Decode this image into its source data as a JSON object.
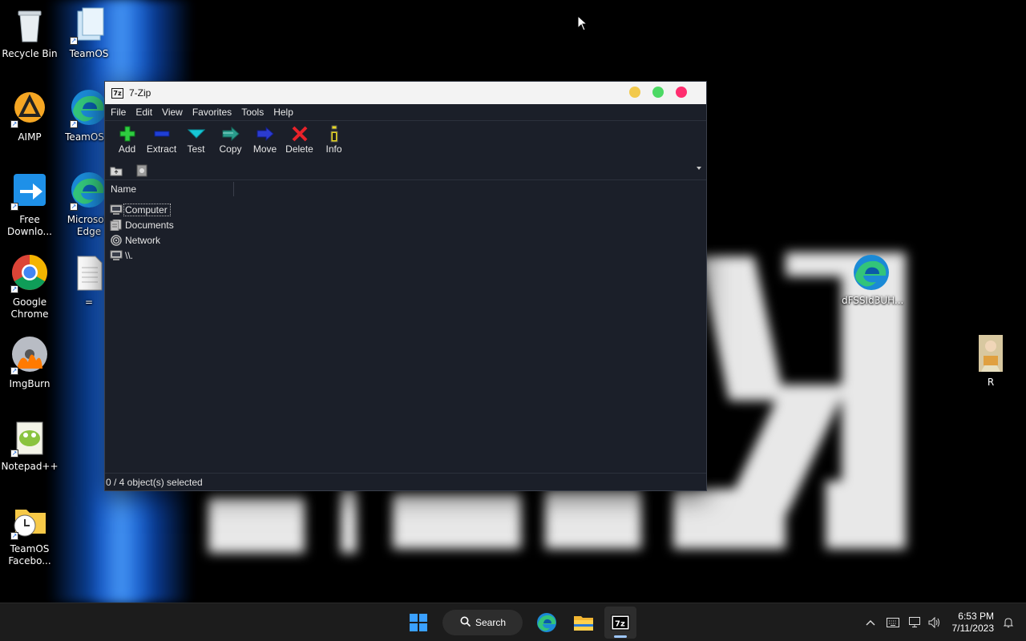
{
  "desktop": {
    "left_icons": [
      {
        "name": "recycle-bin",
        "label": "Recycle Bin"
      },
      {
        "name": "aimp",
        "label": "AIMP"
      },
      {
        "name": "free-download-manager",
        "label": "Free Downlo..."
      },
      {
        "name": "google-chrome",
        "label": "Google Chrome"
      },
      {
        "name": "imgburn",
        "label": "ImgBurn"
      },
      {
        "name": "notepad-plus-plus",
        "label": "Notepad++"
      },
      {
        "name": "teamos-facebook",
        "label": "TeamOS Facebo..."
      }
    ],
    "second_column_icons": [
      {
        "name": "teamos",
        "label": "TeamOS"
      },
      {
        "name": "teamos-edge",
        "label": "TeamOS.x"
      },
      {
        "name": "microsoft-edge",
        "label": "Microsoft Edge"
      },
      {
        "name": "equals-file",
        "label": "="
      }
    ],
    "right_icons": [
      {
        "name": "edge-dfssid",
        "label": "dFSSId3UH..."
      },
      {
        "name": "r-image",
        "label": "R"
      }
    ]
  },
  "window": {
    "title": "7-Zip",
    "app_icon_text": "7z",
    "controls": {
      "minimize_color": "#f2c94c",
      "maximize_color": "#4cd964",
      "close_color": "#ff2d6f"
    },
    "menu": [
      "File",
      "Edit",
      "View",
      "Favorites",
      "Tools",
      "Help"
    ],
    "toolbar": [
      {
        "name": "add",
        "label": "Add",
        "icon": "plus-icon",
        "color": "#2ecc40"
      },
      {
        "name": "extract",
        "label": "Extract",
        "icon": "minus-icon",
        "color": "#1f3fd6"
      },
      {
        "name": "test",
        "label": "Test",
        "icon": "check-icon",
        "color": "#17c6d6"
      },
      {
        "name": "copy",
        "label": "Copy",
        "icon": "double-arrow-icon",
        "color": "#2a9c8c"
      },
      {
        "name": "move",
        "label": "Move",
        "icon": "arrow-right-icon",
        "color": "#2b3bd0"
      },
      {
        "name": "delete",
        "label": "Delete",
        "icon": "x-icon",
        "color": "#e8222a"
      },
      {
        "name": "info",
        "label": "Info",
        "icon": "info-icon",
        "color": "#e8d820"
      }
    ],
    "list": {
      "column_name": "Name",
      "rows": [
        {
          "label": "Computer",
          "icon": "computer-icon",
          "focused": true
        },
        {
          "label": "Documents",
          "icon": "documents-icon",
          "focused": false
        },
        {
          "label": "Network",
          "icon": "network-icon",
          "focused": false
        },
        {
          "label": "\\\\.",
          "icon": "computer-icon",
          "focused": false
        }
      ]
    },
    "status": "0 / 4 object(s) selected"
  },
  "taskbar": {
    "search_label": "Search",
    "pinned": [
      "start-icon",
      "edge-icon",
      "file-explorer-icon",
      "7zip-icon"
    ],
    "active_app": "7zip-icon",
    "time": "6:53 PM",
    "date": "7/11/2023"
  }
}
